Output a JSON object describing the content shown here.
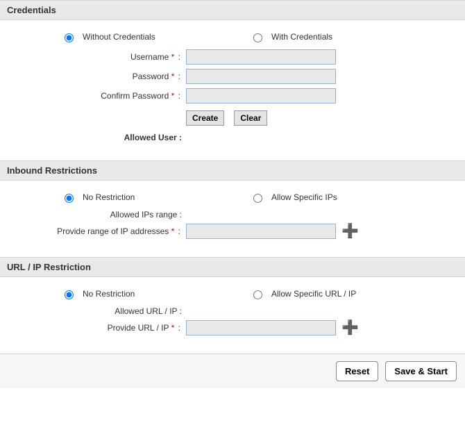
{
  "credentials": {
    "title": "Credentials",
    "radio_without": "Without Credentials",
    "radio_with": "With Credentials",
    "username_label": "Username",
    "password_label": "Password",
    "confirm_password_label": "Confirm Password",
    "create_btn": "Create",
    "clear_btn": "Clear",
    "allowed_user_label": "Allowed User :",
    "username_value": "",
    "password_value": "",
    "confirm_password_value": ""
  },
  "inbound": {
    "title": "Inbound Restrictions",
    "radio_no": "No Restriction",
    "radio_allow": "Allow Specific IPs",
    "allowed_range_label": "Allowed IPs range :",
    "provide_range_label": "Provide range of IP addresses",
    "ip_value": ""
  },
  "url_ip": {
    "title": "URL / IP Restriction",
    "radio_no": "No Restriction",
    "radio_allow": "Allow Specific URL / IP",
    "allowed_label": "Allowed URL / IP :",
    "provide_label": "Provide URL / IP",
    "url_value": ""
  },
  "footer": {
    "reset": "Reset",
    "save_start": "Save & Start"
  },
  "required_mark": "*",
  "colon": ":"
}
